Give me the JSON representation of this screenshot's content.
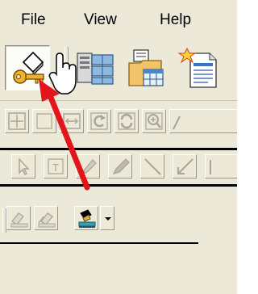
{
  "menu": {
    "file": "File",
    "view": "View",
    "help": "Help"
  },
  "colors": {
    "annotation_arrow": "#e3141b",
    "window_bg": "#ece9d8",
    "disabled_icon": "#a8a698"
  },
  "main_toolbar": {
    "buttons": [
      {
        "icon": "key-icon",
        "state": "pressed"
      },
      {
        "icon": "server-database-icon"
      },
      {
        "icon": "folder-table-icon"
      },
      {
        "icon": "new-document-icon"
      }
    ]
  },
  "nav_toolbar": {
    "buttons": [
      "move-icon",
      "blank-icon",
      "fit-width-icon",
      "rotate-left-icon",
      "refresh-icon",
      "zoom-in-icon",
      "truncated-icon"
    ]
  },
  "draw_toolbar": {
    "buttons": [
      "select-arrow-icon",
      "text-tool-icon",
      "highlighter-icon",
      "pen-icon",
      "line-icon",
      "arrow-line-icon",
      "truncated-icon"
    ]
  },
  "stamp_toolbar": {
    "buttons": [
      "stamp-disabled-icon",
      "stamp-multi-disabled-icon",
      "stamp-active-icon",
      "dropdown-arrow"
    ]
  },
  "cursor": "hand-pointer-cursor",
  "annotation": "red-arrow-pointing-to-key-button"
}
